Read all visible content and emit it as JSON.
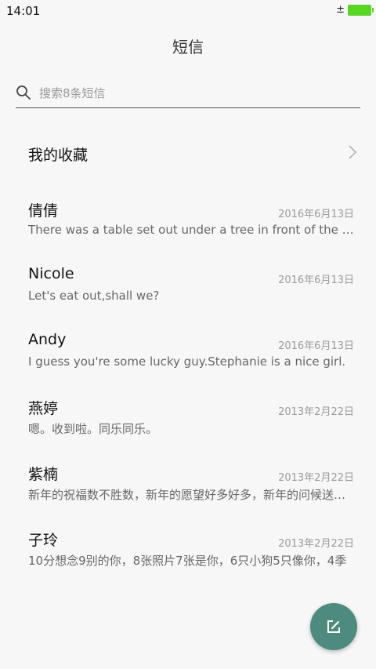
{
  "status_bar": {
    "time": "14:01",
    "charge_glyph": "±",
    "battery_color": "#59d61f"
  },
  "header": {
    "title": "短信"
  },
  "search": {
    "placeholder": "搜索8条短信",
    "value": ""
  },
  "favorites": {
    "label": "我的收藏"
  },
  "messages": [
    {
      "name": "倩倩",
      "date": "2016年6月13日",
      "preview": "There was a table set out under a tree in front of the house"
    },
    {
      "name": "Nicole",
      "date": "2016年6月13日",
      "preview": "Let's eat out,shall we?"
    },
    {
      "name": "Andy",
      "date": "2016年6月13日",
      "preview": "I guess you're some lucky guy.Stephanie is a nice girl."
    },
    {
      "name": "燕婷",
      "date": "2013年2月22日",
      "preview": "嗯。收到啦。同乐同乐。"
    },
    {
      "name": "紫楠",
      "date": "2013年2月22日",
      "preview": "新年的祝福数不胜数，新年的愿望好多好多，新年的问候送给你"
    },
    {
      "name": "子玲",
      "date": "2013年2月22日",
      "preview": "10分想念9别的你，8张照片7张是你，6只小狗5只像你，4季"
    }
  ],
  "fab": {
    "icon": "compose-icon",
    "color": "#4c8b7e"
  }
}
